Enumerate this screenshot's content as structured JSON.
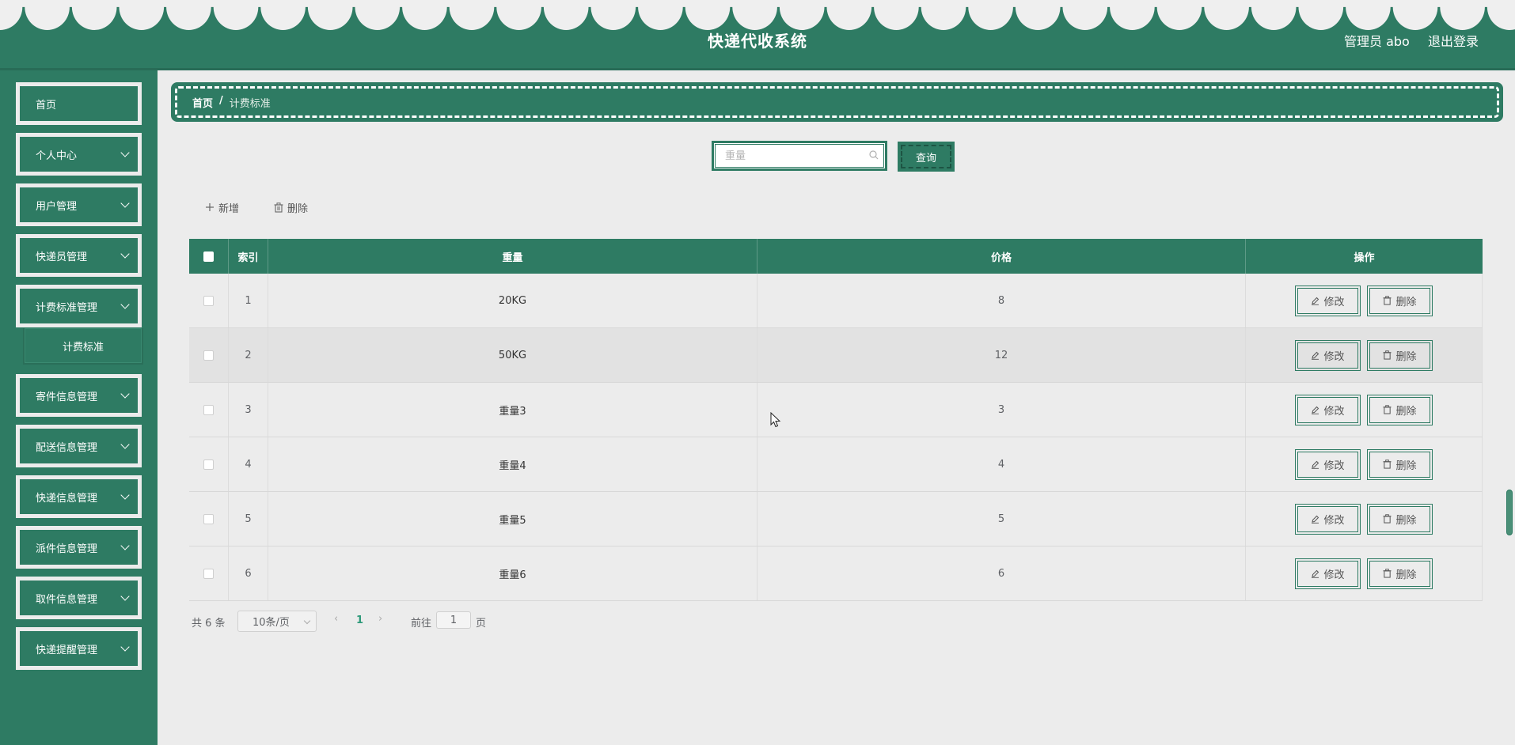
{
  "app": {
    "title": "快递代收系统",
    "admin_label": "管理员 abo",
    "logout_label": "退出登录"
  },
  "colors": {
    "primary": "#2e7b63",
    "background": "#ececec"
  },
  "sidebar": {
    "items": [
      {
        "label": "首页",
        "has_children": false
      },
      {
        "label": "个人中心",
        "has_children": true
      },
      {
        "label": "用户管理",
        "has_children": true
      },
      {
        "label": "快递员管理",
        "has_children": true
      },
      {
        "label": "计费标准管理",
        "has_children": true,
        "expanded": true
      },
      {
        "label": "寄件信息管理",
        "has_children": true
      },
      {
        "label": "配送信息管理",
        "has_children": true
      },
      {
        "label": "快递信息管理",
        "has_children": true
      },
      {
        "label": "派件信息管理",
        "has_children": true
      },
      {
        "label": "取件信息管理",
        "has_children": true
      },
      {
        "label": "快递提醒管理",
        "has_children": true
      }
    ],
    "submenu": {
      "label": "计费标准"
    }
  },
  "breadcrumb": {
    "home": "首页",
    "separator": "/",
    "current": "计费标准"
  },
  "search": {
    "placeholder": "重量",
    "value": "",
    "button_label": "查询"
  },
  "toolbar": {
    "add_label": "新增",
    "delete_label": "删除"
  },
  "table": {
    "columns": {
      "select": "",
      "index": "索引",
      "weight": "重量",
      "price": "价格",
      "actions": "操作"
    },
    "rows": [
      {
        "index": "1",
        "weight": "20KG",
        "price": "8"
      },
      {
        "index": "2",
        "weight": "50KG",
        "price": "12"
      },
      {
        "index": "3",
        "weight": "重量3",
        "price": "3"
      },
      {
        "index": "4",
        "weight": "重量4",
        "price": "4"
      },
      {
        "index": "5",
        "weight": "重量5",
        "price": "5"
      },
      {
        "index": "6",
        "weight": "重量6",
        "price": "6"
      }
    ],
    "edit_label": "修改",
    "delete_label": "删除"
  },
  "pagination": {
    "total": "共 6 条",
    "page_size": "10条/页",
    "current_page": "1",
    "goto_label": "前往",
    "goto_value": "1",
    "page_unit": "页"
  }
}
